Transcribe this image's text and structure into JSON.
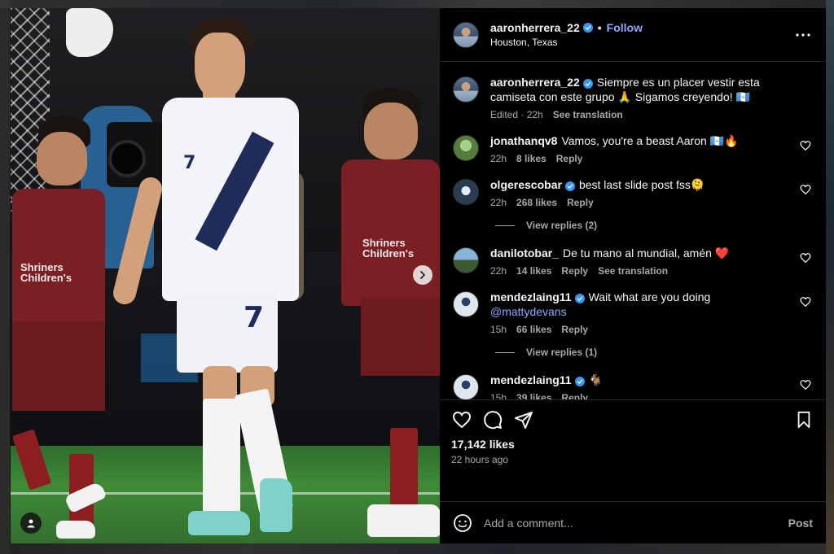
{
  "post": {
    "author": {
      "username": "aaronherrera_22",
      "verified": true,
      "follow_label": "Follow",
      "separator": "•",
      "location": "Houston, Texas"
    },
    "caption": {
      "username": "aaronherrera_22",
      "text": "Siempre es un placer vestir esta camiseta con este grupo 🙏 Sigamos creyendo! 🇬🇹",
      "edited_label": "Edited · 22h",
      "see_translation": "See translation"
    },
    "media": {
      "shirt_text_left": "Shriners Children's",
      "shirt_text_right": "Shriners Children's",
      "player_number": "7",
      "next_icon": "chevron-right-icon",
      "user_tag_icon": "person-icon"
    },
    "comments": [
      {
        "username": "jonathanqv8",
        "verified": false,
        "text": "Vamos, you're a beast Aaron 🇬🇹🔥",
        "time": "22h",
        "likes": "8 likes",
        "reply": "Reply",
        "extra": ""
      },
      {
        "username": "olgerescobar",
        "verified": true,
        "text": "best last slide post fss🫠",
        "time": "22h",
        "likes": "268 likes",
        "reply": "Reply",
        "extra": "",
        "view_replies": "View replies (2)"
      },
      {
        "username": "danilotobar_",
        "verified": false,
        "text": "De tu mano al mundial, amén ❤️",
        "time": "22h",
        "likes": "14 likes",
        "reply": "Reply",
        "extra": "See translation"
      },
      {
        "username": "mendezlaing11",
        "verified": true,
        "text_before": "Wait what are you doing ",
        "mention": "@mattydevans",
        "time": "15h",
        "likes": "66 likes",
        "reply": "Reply",
        "extra": "",
        "view_replies": "View replies (1)"
      },
      {
        "username": "mendezlaing11",
        "verified": true,
        "text": "🐐",
        "time": "15h",
        "likes": "39 likes",
        "reply": "Reply",
        "extra": ""
      }
    ],
    "actions": {
      "like_icon": "heart-icon",
      "comment_icon": "comment-icon",
      "share_icon": "send-icon",
      "save_icon": "bookmark-icon"
    },
    "likes_count": "17,142 likes",
    "posted_ago": "22 hours ago",
    "composer": {
      "placeholder": "Add a comment...",
      "post_label": "Post"
    },
    "colors": {
      "accent": "#8fa9ff",
      "verified": "#3897f0",
      "panel_bg": "#000000",
      "muted": "#a8a8a8",
      "heart_red": "#ed4956"
    }
  }
}
